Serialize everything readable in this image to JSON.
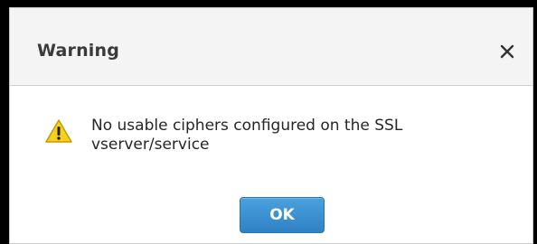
{
  "dialog": {
    "title": "Warning",
    "close_icon": "close-icon",
    "warning_icon": "warning-icon",
    "message": "No usable ciphers configured on the SSL vserver/service",
    "ok_label": "OK"
  },
  "colors": {
    "header_background": "#f4f4f4",
    "ok_button": "#3a8fd2",
    "warning_yellow": "#f6d21f"
  }
}
